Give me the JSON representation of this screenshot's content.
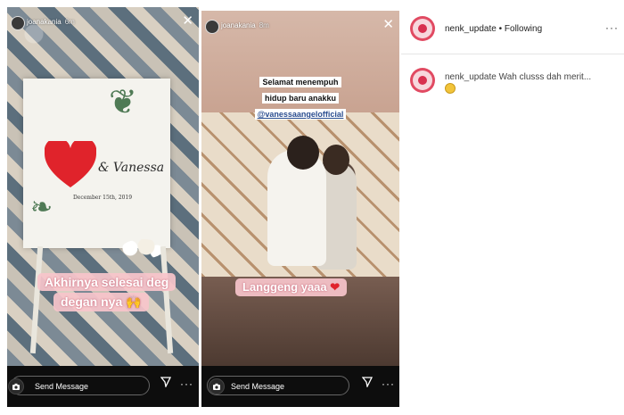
{
  "story1": {
    "username": "joanakania",
    "time": "6m",
    "card_name": "& Vanessa",
    "card_date": "December 15th, 2019",
    "caption_line1": "Akhirnya selesai deg",
    "caption_line2": "degan nya",
    "caption_emoji": "🙌",
    "message_placeholder": "Send Message"
  },
  "story2": {
    "username": "joanakania",
    "time": "8m",
    "text_line1": "Selamat menempuh",
    "text_line2": "hidup baru anakku",
    "mention": "@vanessaangelofficial",
    "caption": "Langgeng yaaa",
    "caption_emoji": "❤",
    "message_placeholder": "Send Message"
  },
  "post": {
    "username": "nenk_update",
    "follow_status": "• Following",
    "more": "···"
  },
  "comment": {
    "username": "nenk_update",
    "text": "Wah clusss dah merit..."
  },
  "icons": {
    "close": "close-icon",
    "camera": "camera-icon",
    "send": "send-icon",
    "more": "more-icon"
  },
  "colors": {
    "accent": "#e14a62",
    "pill": "#f7c4cb"
  }
}
